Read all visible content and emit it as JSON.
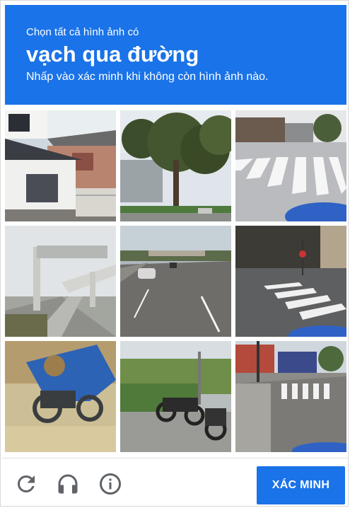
{
  "header": {
    "prompt": "Chọn tất cả hình ảnh có",
    "target": "vạch qua đường",
    "hint": "Nhấp vào xác minh khi không còn hình ảnh nào."
  },
  "tiles": [
    {
      "description": "house"
    },
    {
      "description": "trees-street"
    },
    {
      "description": "crosswalk-intersection"
    },
    {
      "description": "highway-overpass"
    },
    {
      "description": "highway-cars"
    },
    {
      "description": "crosswalk-street-wall"
    },
    {
      "description": "motorcycle-tarp"
    },
    {
      "description": "parked-motorcycles"
    },
    {
      "description": "crosswalk-town"
    }
  ],
  "footer": {
    "reload_icon": "reload-icon",
    "audio_icon": "headphones-icon",
    "info_icon": "info-icon",
    "verify_label": "XÁC MINH"
  },
  "colors": {
    "accent": "#1a73e8",
    "icon_gray": "#5f6368"
  }
}
